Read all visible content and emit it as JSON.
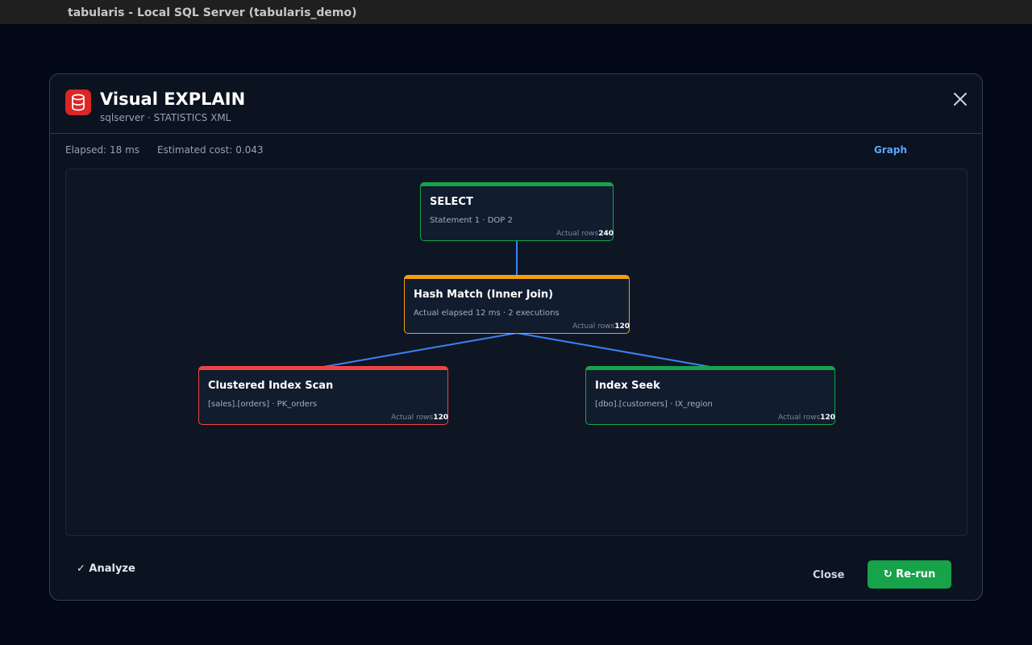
{
  "window": {
    "title": "tabularis - Local SQL Server (tabularis_demo)"
  },
  "dialog": {
    "title": "Visual EXPLAIN",
    "subtitle": "sqlserver · STATISTICS XML",
    "icon": "database-icon",
    "close_icon": "close-icon"
  },
  "stats": {
    "elapsed": "Elapsed: 18 ms",
    "cost": "Estimated cost: 0.043",
    "view_mode": "Graph"
  },
  "colors": {
    "good": "#16a34a",
    "warning": "#f59e0b",
    "bad": "#ef4444",
    "edge": "#3b82f6",
    "accent": "#60a5fa"
  },
  "plan": {
    "nodes": [
      {
        "title": "SELECT",
        "detail": "Statement 1 · DOP 2",
        "rows_label": "Actual rows",
        "rows": "240",
        "status": "good"
      },
      {
        "title": "Hash Match (Inner Join)",
        "detail": "Actual elapsed 12 ms · 2 executions",
        "rows_label": "Actual rows",
        "rows": "120",
        "status": "warning"
      },
      {
        "title": "Clustered Index Scan",
        "detail": "[sales].[orders] · PK_orders",
        "rows_label": "Actual rows",
        "rows": "120",
        "status": "bad"
      },
      {
        "title": "Index Seek",
        "detail": "[dbo].[customers] · IX_region",
        "rows_label": "Actual rows",
        "rows": "120",
        "status": "good"
      }
    ]
  },
  "footer": {
    "analyze": "✓ Analyze",
    "close": "Close",
    "rerun": "↻ Re-run"
  }
}
